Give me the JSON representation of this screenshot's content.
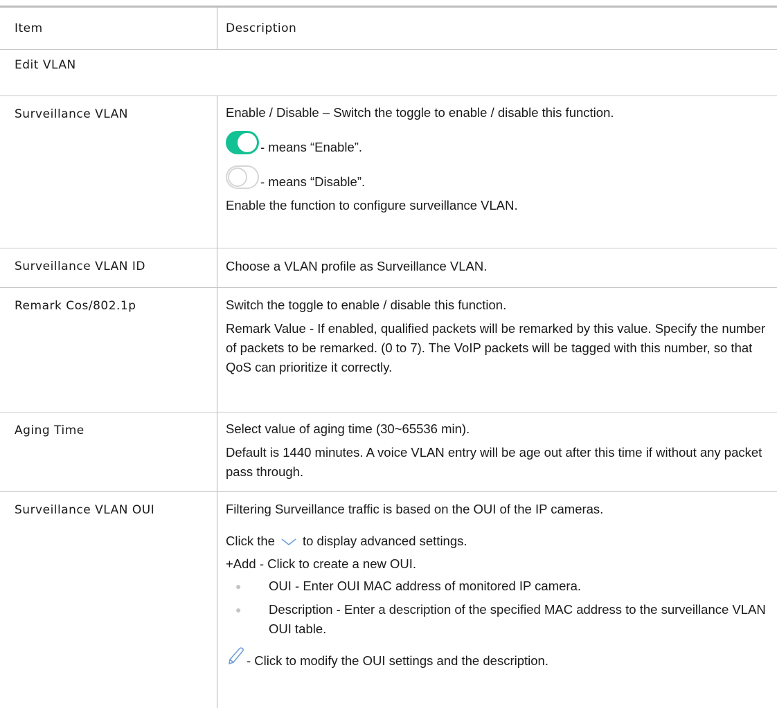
{
  "table": {
    "header": {
      "item": "Item",
      "description": "Description"
    },
    "section_title": "Edit VLAN",
    "rows": {
      "surveillance_vlan": {
        "item": "Surveillance VLAN",
        "lines": [
          "Enable / Disable – Switch the toggle to enable / disable this function.",
          "- means “Enable”.",
          "- means “Disable”.",
          "Enable the function to configure surveillance VLAN."
        ]
      },
      "vlan_id": {
        "item": "Surveillance VLAN ID",
        "lines": [
          "Choose a VLAN profile as Surveillance VLAN."
        ]
      },
      "remark": {
        "item": "Remark Cos/802.1p",
        "lines": [
          "Switch the toggle to enable / disable this function.",
          "Remark Value - If enabled, qualified packets will be remarked by this value. Specify the number of packets to be remarked. (0 to 7). The VoIP packets will be tagged with this number, so that QoS can prioritize it correctly."
        ]
      },
      "aging": {
        "item": "Aging Time",
        "lines": [
          "Select value of aging time (30~65536 min).",
          "Default is 1440 minutes. A voice VLAN entry will be age out after this time if without any packet pass through."
        ]
      },
      "oui": {
        "item": "Surveillance VLAN OUI",
        "lines": [
          "Filtering Surveillance traffic is based on the OUI of the IP cameras.",
          "Click the",
          "to display advanced settings.",
          "+Add - Click to create a new OUI.",
          "OUI - Enter OUI MAC address of monitored IP camera.",
          "Description - Enter a description of the specified MAC address to the surveillance VLAN OUI table.",
          "- Click to modify the OUI settings and the description."
        ]
      }
    }
  },
  "colors": {
    "toggle_on": "#12c294",
    "toggle_off_border": "#d6d6d6",
    "icon_blue": "#6f9fd8"
  }
}
